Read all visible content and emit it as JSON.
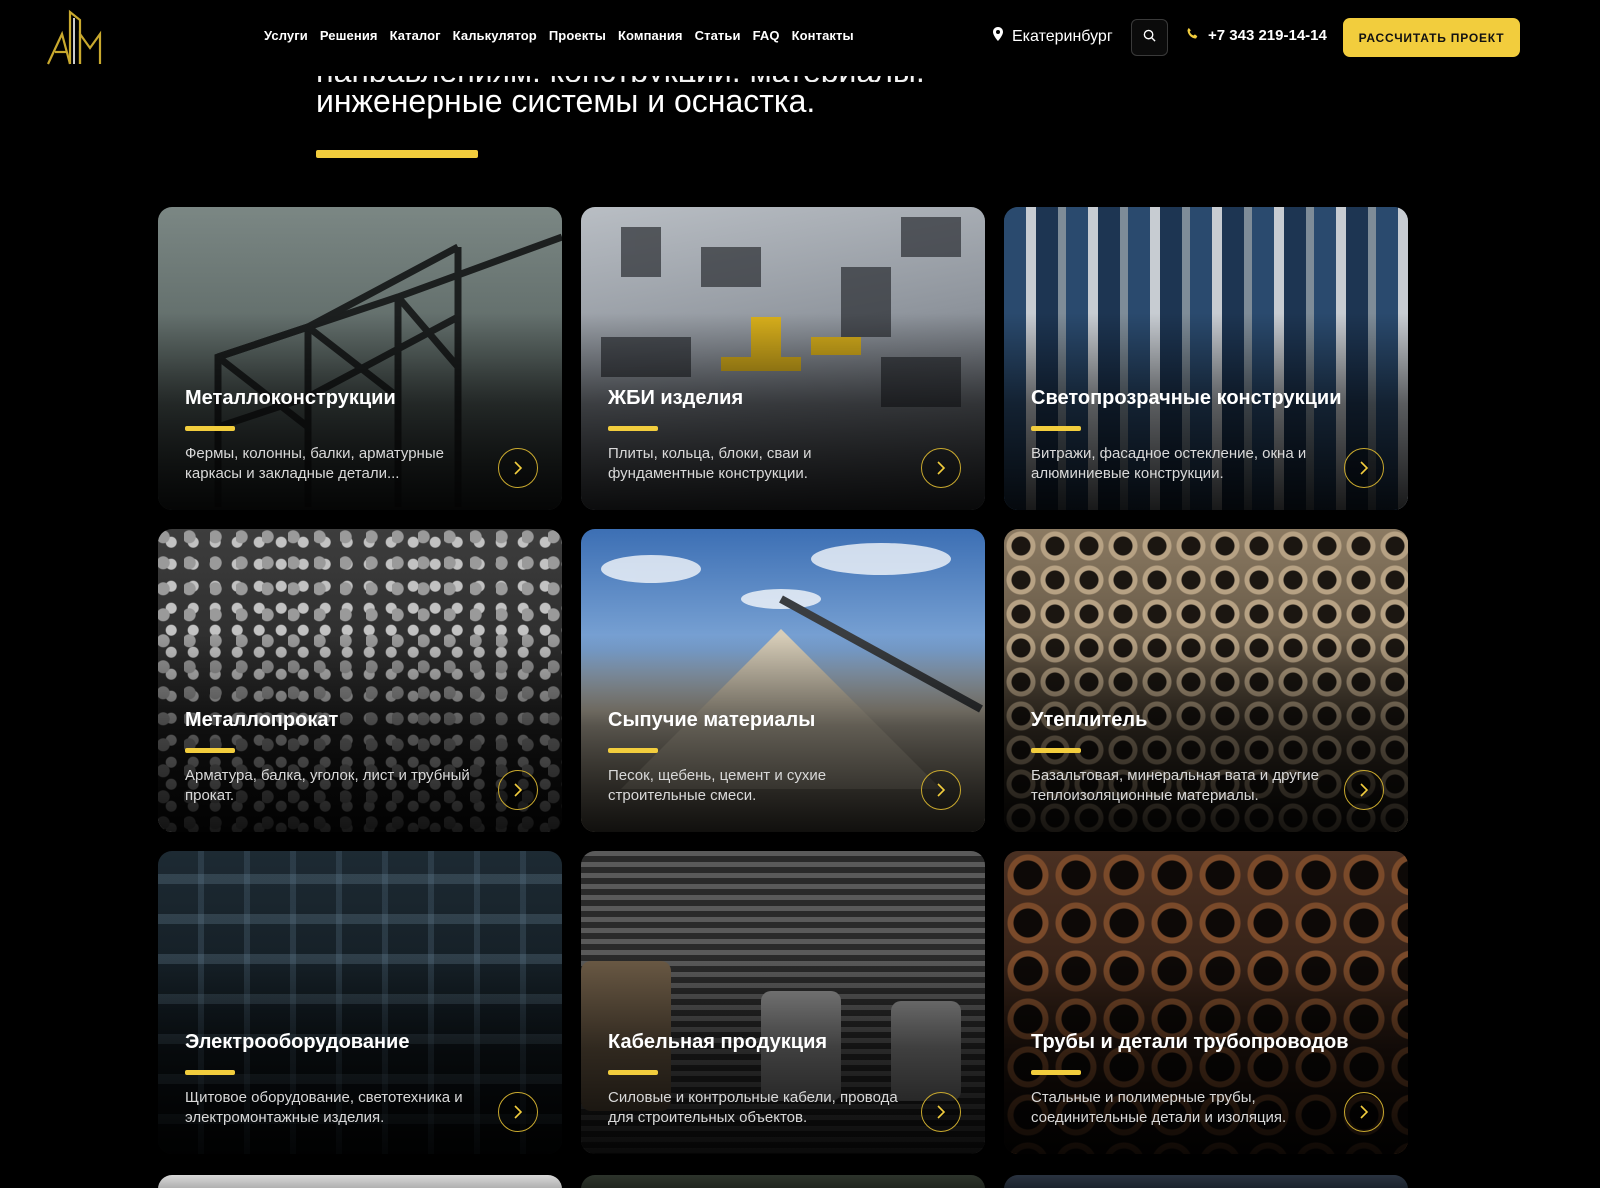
{
  "header": {
    "nav": [
      "Услуги",
      "Решения",
      "Каталог",
      "Калькулятор",
      "Проекты",
      "Компания",
      "Статьи",
      "FAQ",
      "Контакты"
    ],
    "city": "Екатеринбург",
    "phone": "+7 343 219-14-14",
    "cta": "РАССЧИТАТЬ ПРОЕКТ"
  },
  "intro": {
    "line1": "направлениям: конструкции, материалы,",
    "line2": "инженерные системы и оснастка."
  },
  "cards": [
    {
      "title": "Металлоконструкции",
      "desc": "Фермы, колонны, балки, арматурные каркасы и закладные детали..."
    },
    {
      "title": "ЖБИ изделия",
      "desc": "Плиты, кольца, блоки, сваи и фундаментные конструкции."
    },
    {
      "title": "Светопрозрачные конструкции",
      "desc": "Витражи, фасадное остекление, окна и алюминиевые конструкции."
    },
    {
      "title": "Металлопрокат",
      "desc": "Арматура, балка, уголок, лист и трубный прокат."
    },
    {
      "title": "Сыпучие материалы",
      "desc": "Песок, щебень, цемент и сухие строительные смеси."
    },
    {
      "title": "Утеплитель",
      "desc": "Базальтовая, минеральная вата и другие теплоизоляционные материалы."
    },
    {
      "title": "Электрооборудование",
      "desc": "Щитовое оборудование, светотехника и электромонтажные изделия."
    },
    {
      "title": "Кабельная продукция",
      "desc": "Силовые и контрольные кабели, провода для строительных объектов."
    },
    {
      "title": "Трубы и детали трубопроводов",
      "desc": "Стальные и полимерные трубы, соединительные детали и изоляция."
    }
  ],
  "colors": {
    "accent": "#f2cd3d",
    "background": "#000000"
  }
}
